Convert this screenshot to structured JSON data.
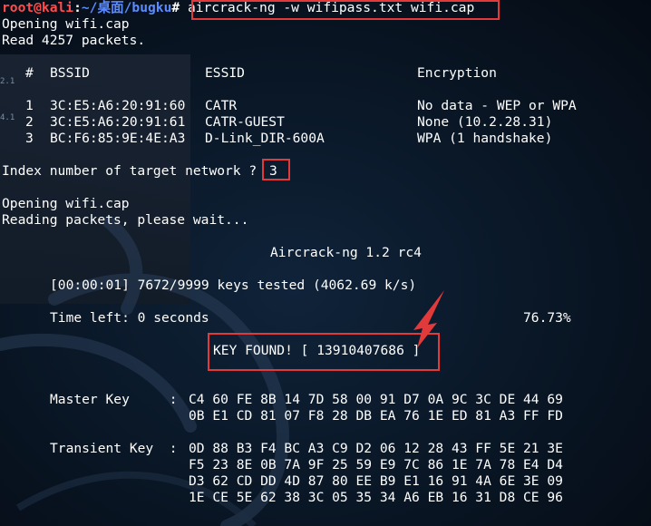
{
  "prompt": {
    "user_host": "root@kali",
    "sep": ":",
    "path": "~/桌面/bugku",
    "symbol": "#",
    "command": "aircrack-ng -w wifipass.txt wifi.cap"
  },
  "output": {
    "opening1": "Opening wifi.cap",
    "read_packets": "Read 4257 packets.",
    "header": {
      "num": "#",
      "bssid": "BSSID",
      "essid": "ESSID",
      "encryption": "Encryption"
    },
    "networks": [
      {
        "num": "1",
        "bssid": "3C:E5:A6:20:91:60",
        "essid": "CATR",
        "encryption": "No data - WEP or WPA"
      },
      {
        "num": "2",
        "bssid": "3C:E5:A6:20:91:61",
        "essid": "CATR-GUEST",
        "encryption": "None (10.2.28.31)"
      },
      {
        "num": "3",
        "bssid": "BC:F6:85:9E:4E:A3",
        "essid": "D-Link_DIR-600A",
        "encryption": "WPA (1 handshake)"
      }
    ],
    "index_prompt": "Index number of target network ?",
    "index_value": "3",
    "opening2": "Opening wifi.cap",
    "reading": "Reading packets, please wait...",
    "banner": "Aircrack-ng 1.2 rc4",
    "keys_tested": "[00:00:01] 7672/9999 keys tested (4062.69 k/s)",
    "time_left": "Time left: 0 seconds",
    "percent": "76.73%",
    "key_found": "KEY FOUND! [ 13910407686 ]",
    "master_key_label": "Master Key     :",
    "master_key": [
      "C4 60 FE 8B 14 7D 58 00 91 D7 0A 9C 3C DE 44 69",
      "0B E1 CD 81 07 F8 28 DB EA 76 1E ED 81 A3 FF FD"
    ],
    "transient_key_label": "Transient Key  :",
    "transient_key": [
      "0D 88 B3 F4 BC A3 C9 D2 06 12 28 43 FF 5E 21 3E",
      "F5 23 8E 0B 7A 9F 25 59 E9 7C 86 1E 7A 78 E4 D4",
      "D3 62 CD DD 4D 87 80 EE B9 E1 16 91 4A 6E 3E 09",
      "1E CE 5E 62 38 3C 05 35 34 A6 EB 16 31 D8 CE 96"
    ]
  },
  "colors": {
    "highlight_box": "#e23a3a",
    "user": "#ff4d4d",
    "path": "#5b8cff"
  },
  "left_edge_fragments": [
    "2.1",
    "4.1"
  ]
}
